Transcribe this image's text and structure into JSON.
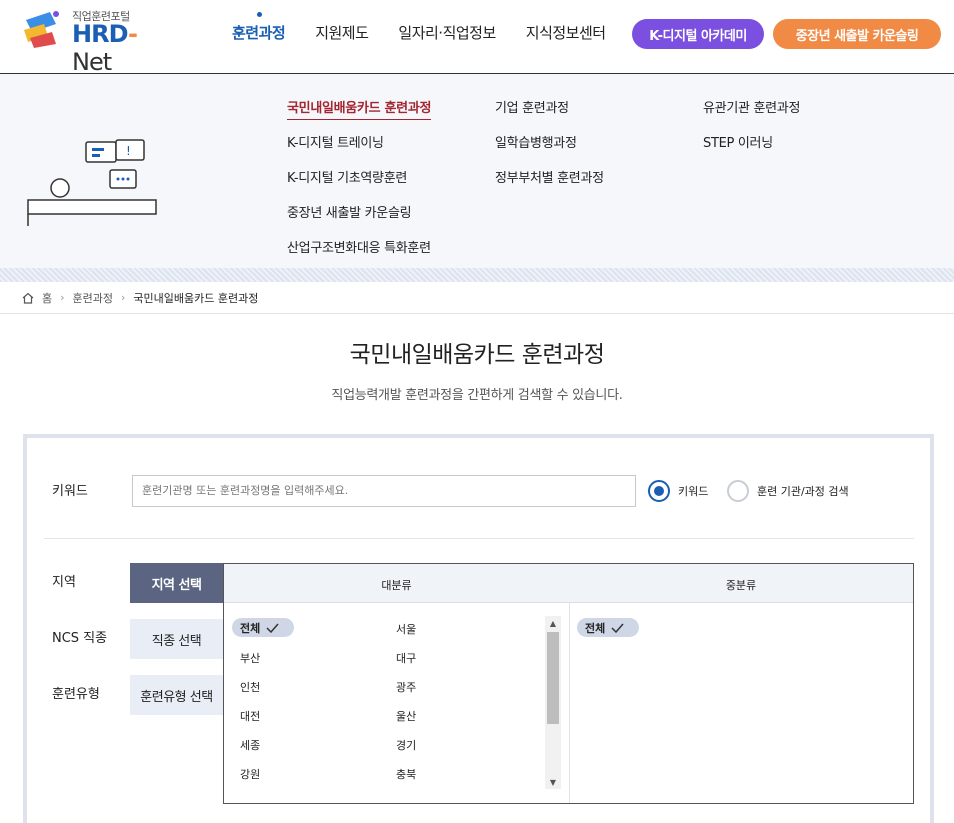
{
  "header": {
    "logo_sub": "직업훈련포털",
    "logo_main": "HRD",
    "logo_dash": "-",
    "logo_net": "Net",
    "nav": [
      "훈련과정",
      "지원제도",
      "일자리·직업정보",
      "지식정보센터"
    ],
    "active_nav": "훈련과정",
    "pill_k": "K-디지털 아카데미",
    "pill_counsel": "중장년 새출발 카운슬링",
    "colors": {
      "brand": "#1a5fb4",
      "pill_k": "#7b4fe0",
      "pill_counsel": "#f08a45",
      "selected": "#a4242f"
    }
  },
  "mega": {
    "col1": [
      "국민내일배움카드 훈련과정",
      "K-디지털 트레이닝",
      "K-디지털 기초역량훈련",
      "중장년 새출발 카운슬링",
      "산업구조변화대응 특화훈련"
    ],
    "col2": [
      "기업 훈련과정",
      "일학습병행과정",
      "정부부처별 훈련과정"
    ],
    "col3": [
      "유관기관 훈련과정",
      "STEP 이러닝"
    ],
    "selected": "국민내일배움카드 훈련과정"
  },
  "breadcrumb": {
    "home": "홈",
    "level1": "훈련과정",
    "current": "국민내일배움카드 훈련과정"
  },
  "page": {
    "title": "국민내일배움카드 훈련과정",
    "desc": "직업능력개발 훈련과정을 간편하게 검색할 수 있습니다."
  },
  "search": {
    "keyword_label": "키워드",
    "keyword_placeholder": "훈련기관명 또는 훈련과정명을 입력해주세요.",
    "keyword_value": "",
    "radio_keyword": "키워드",
    "radio_inst": "훈련 기관/과정 검색",
    "radio_selected": "키워드"
  },
  "filters": {
    "labels": [
      "지역",
      "NCS 직종",
      "훈련유형"
    ],
    "buttons": [
      "지역 선택",
      "직종 선택",
      "훈련유형 선택"
    ],
    "active": "지역 선택"
  },
  "grid": {
    "head_major": "대분류",
    "head_middle": "중분류",
    "major_left": [
      "전체",
      "부산",
      "인천",
      "대전",
      "세종",
      "강원"
    ],
    "major_right": [
      "서울",
      "대구",
      "광주",
      "울산",
      "경기",
      "충북"
    ],
    "middle": [
      "전체"
    ]
  }
}
